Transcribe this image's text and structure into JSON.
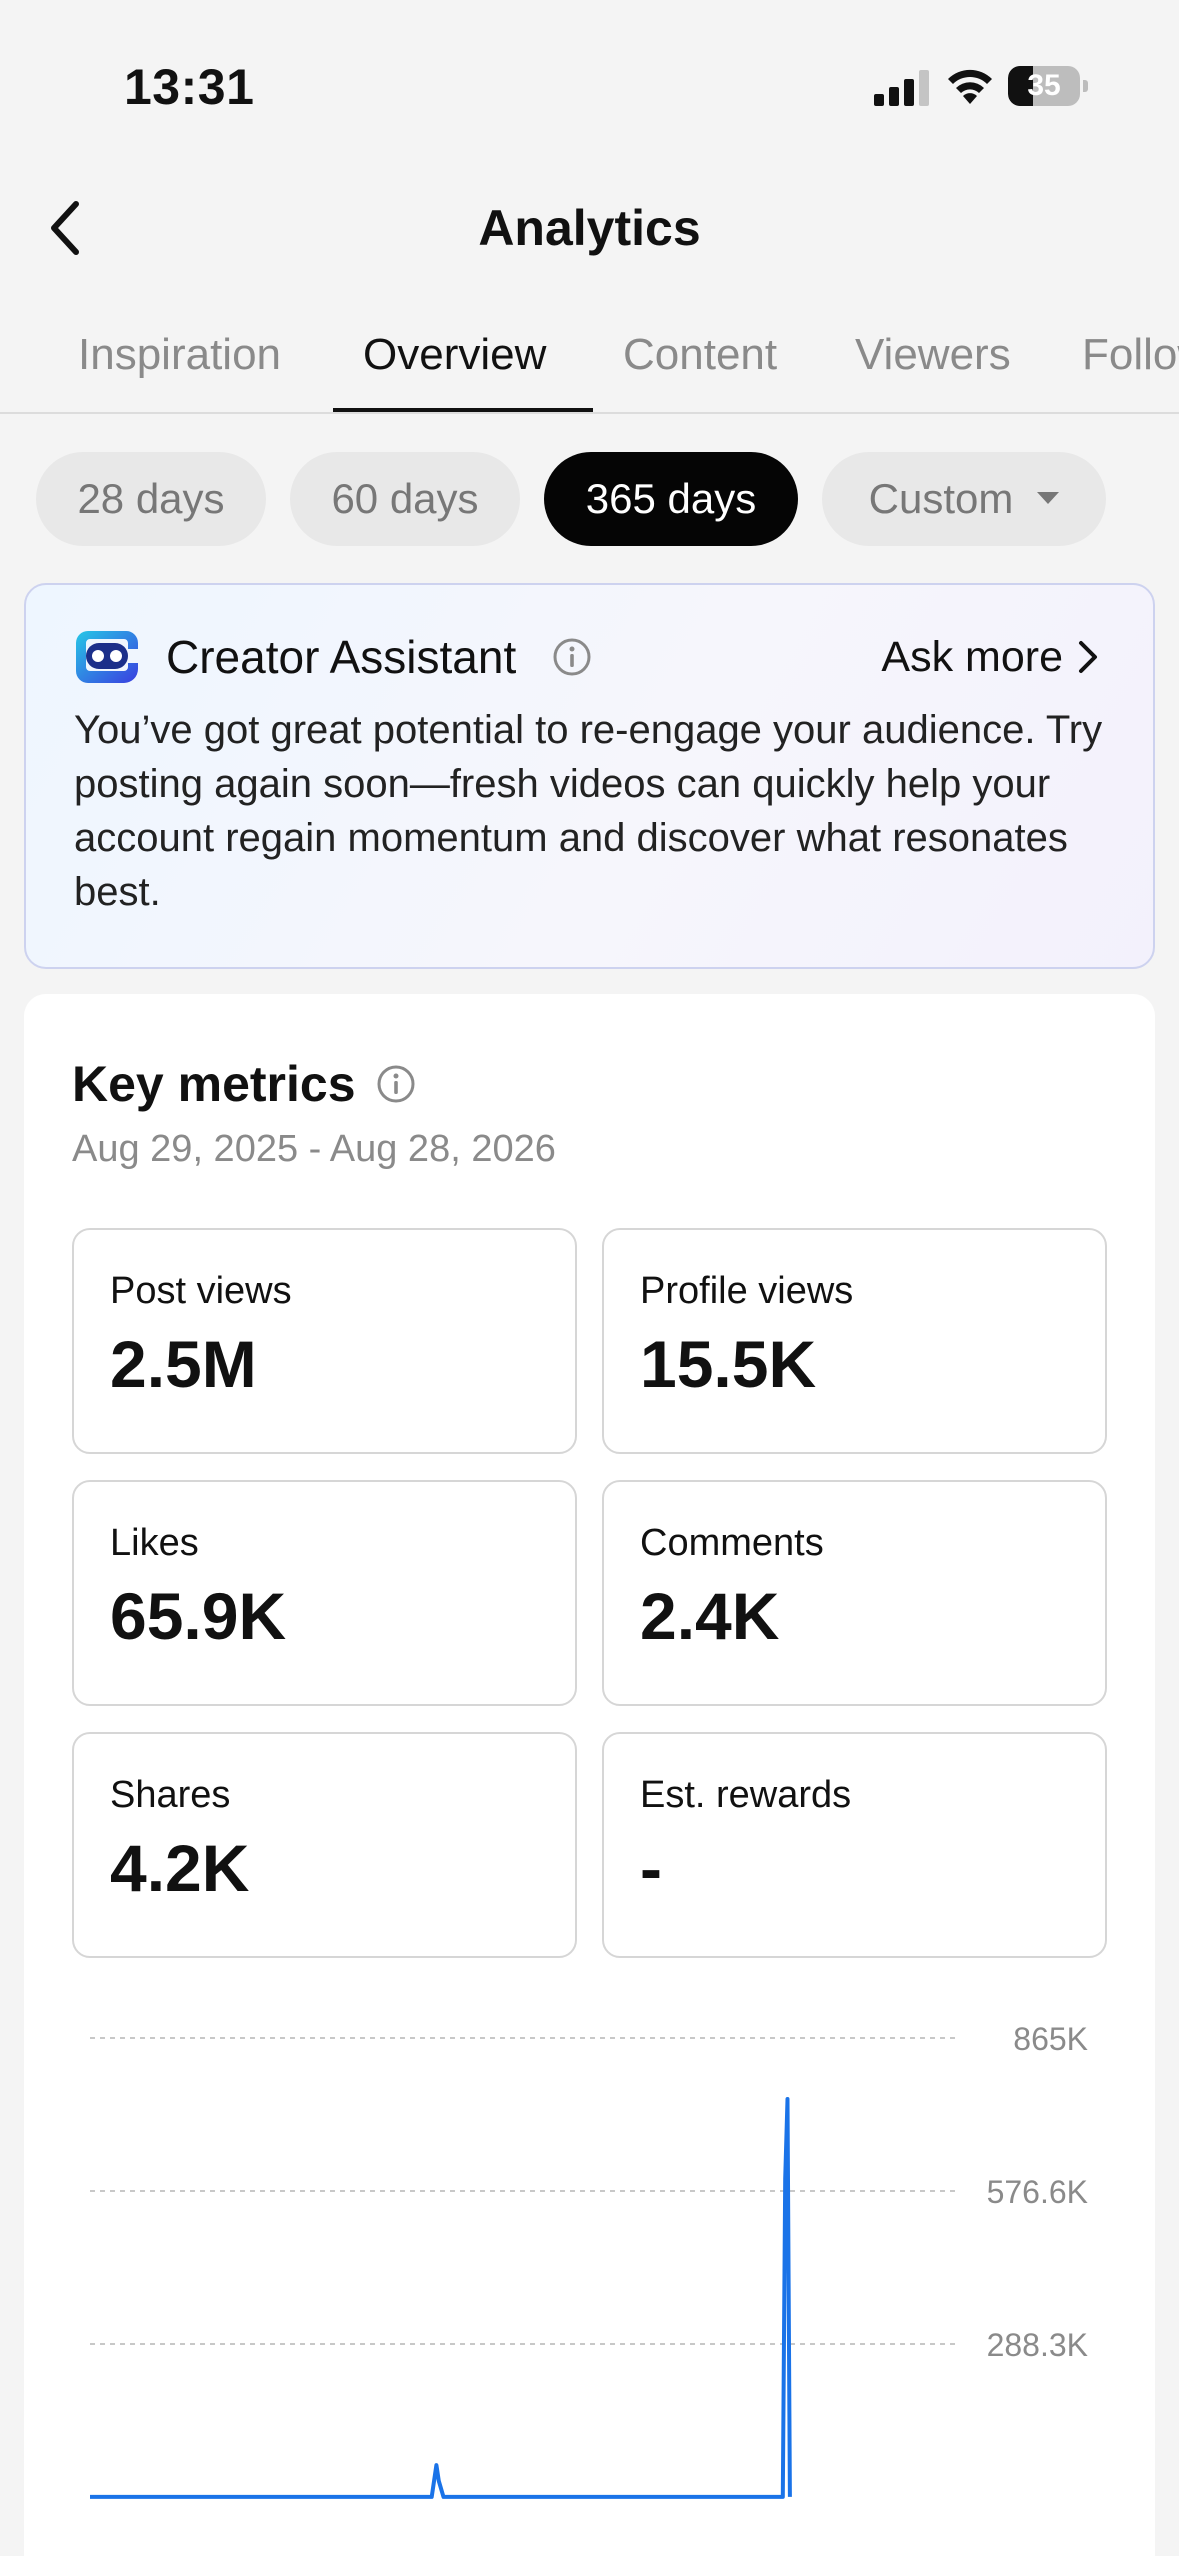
{
  "status_bar": {
    "time": "13:31",
    "battery": "35"
  },
  "header": {
    "title": "Analytics"
  },
  "tabs": [
    {
      "label": "Inspiration",
      "active": false
    },
    {
      "label": "Overview",
      "active": true
    },
    {
      "label": "Content",
      "active": false
    },
    {
      "label": "Viewers",
      "active": false
    },
    {
      "label": "Followers",
      "active": false
    }
  ],
  "periods": [
    {
      "label": "28 days",
      "active": false
    },
    {
      "label": "60 days",
      "active": false
    },
    {
      "label": "365 days",
      "active": true
    },
    {
      "label": "Custom",
      "active": false
    }
  ],
  "assistant": {
    "title": "Creator Assistant",
    "ask_more": "Ask more",
    "message": "You’ve got great potential to re-engage your audience. Try posting again soon—fresh videos can quickly help your account regain momentum and discover what resonates best."
  },
  "key_metrics": {
    "title": "Key metrics",
    "range": "Aug 29, 2025 - Aug 28, 2026",
    "tiles": [
      {
        "label": "Post views",
        "value": "2.5M",
        "selected": true
      },
      {
        "label": "Profile views",
        "value": "15.5K",
        "selected": false
      },
      {
        "label": "Likes",
        "value": "65.9K",
        "selected": false
      },
      {
        "label": "Comments",
        "value": "2.4K",
        "selected": false
      },
      {
        "label": "Shares",
        "value": "4.2K",
        "selected": false
      },
      {
        "label": "Est. rewards",
        "value": "-",
        "selected": false
      }
    ]
  },
  "colors": {
    "accent": "#1f6fc4",
    "chart_line": "#1a73e8",
    "active_chip": "#050505"
  },
  "chart_data": {
    "type": "line",
    "series_name": "Post views",
    "y_ticks": [
      {
        "value": 865000,
        "label": "865K"
      },
      {
        "value": 576600,
        "label": "576.6K"
      },
      {
        "value": 288300,
        "label": "288.3K"
      }
    ],
    "ylim": [
      0,
      865000
    ],
    "x_range_days": [
      0,
      365
    ],
    "points": [
      {
        "day": 0,
        "views": 0
      },
      {
        "day": 144,
        "views": 0
      },
      {
        "day": 146,
        "views": 60000
      },
      {
        "day": 147,
        "views": 30000
      },
      {
        "day": 149,
        "views": 0
      },
      {
        "day": 292,
        "views": 0
      },
      {
        "day": 293,
        "views": 600000
      },
      {
        "day": 294,
        "views": 750000
      },
      {
        "day": 295,
        "views": 0
      }
    ]
  }
}
